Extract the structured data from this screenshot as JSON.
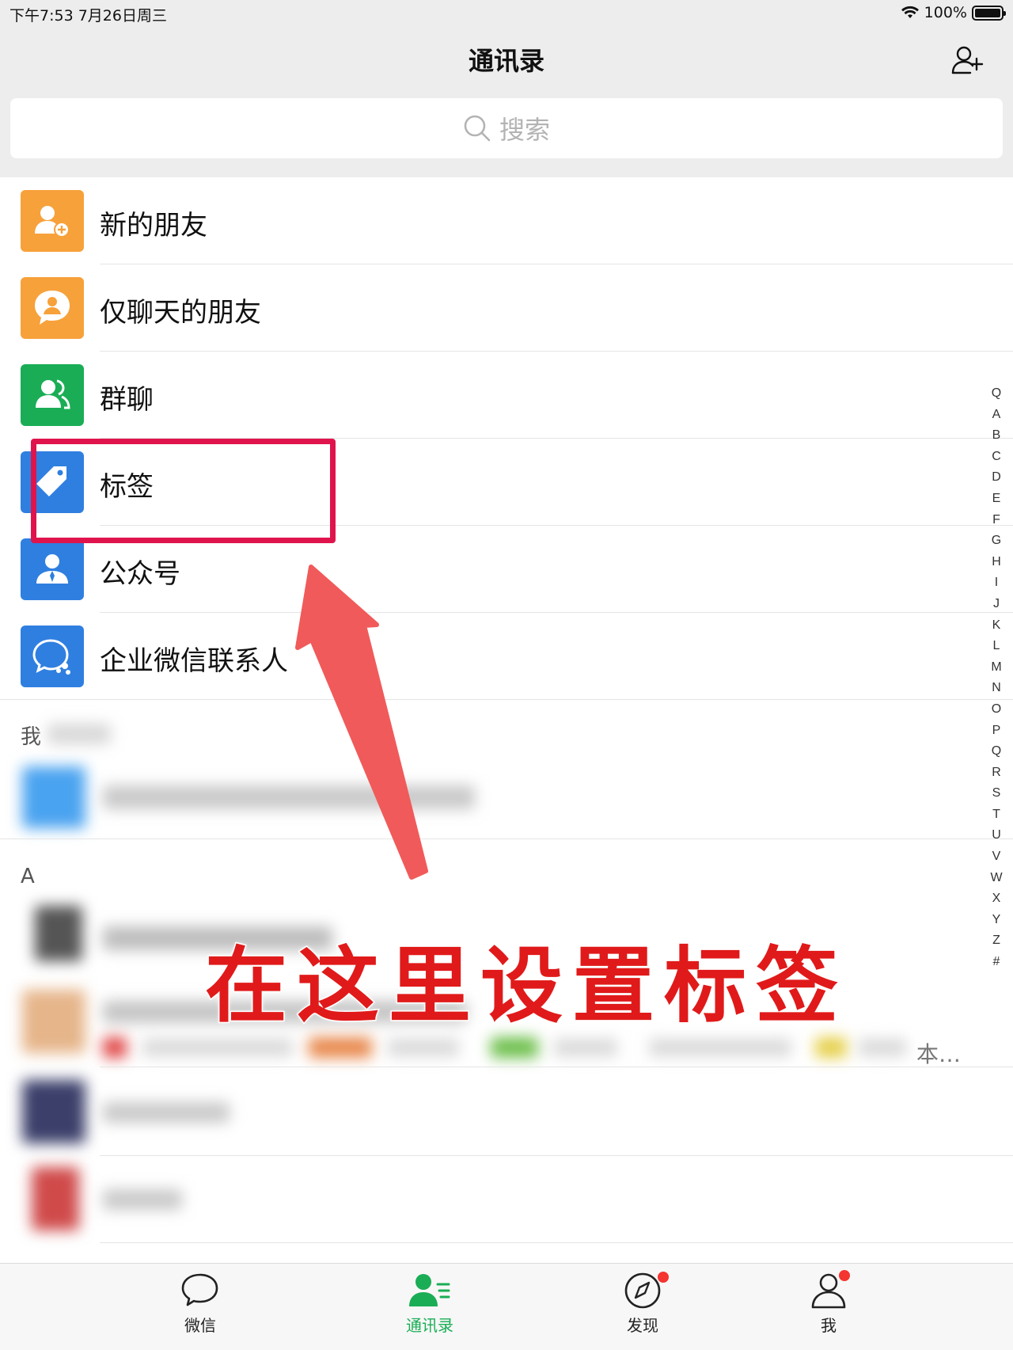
{
  "status_bar": {
    "time": "下午7:53   7月26日周三",
    "battery": "100%"
  },
  "nav": {
    "title": "通讯录",
    "add_contact_icon": "add-contact-icon"
  },
  "search": {
    "placeholder": "搜索"
  },
  "list_items": [
    {
      "label": "新的朋友",
      "icon": "new-friend-icon",
      "color": "#f7a13a"
    },
    {
      "label": "仅聊天的朋友",
      "icon": "chat-only-friend-icon",
      "color": "#f7a13a"
    },
    {
      "label": "群聊",
      "icon": "group-chat-icon",
      "color": "#1aad55"
    },
    {
      "label": "标签",
      "icon": "tag-icon",
      "color": "#2f7fe0"
    },
    {
      "label": "公众号",
      "icon": "official-account-icon",
      "color": "#2f7fe0"
    },
    {
      "label": "企业微信联系人",
      "icon": "wecom-contact-icon",
      "color": "#2f7fe0"
    }
  ],
  "sections": {
    "mine": "我",
    "a": "A",
    "truncated_text": "本…"
  },
  "index_bar": [
    "Q",
    "A",
    "B",
    "C",
    "D",
    "E",
    "F",
    "G",
    "H",
    "I",
    "J",
    "K",
    "L",
    "M",
    "N",
    "O",
    "P",
    "Q",
    "R",
    "S",
    "T",
    "U",
    "V",
    "W",
    "X",
    "Y",
    "Z",
    "#"
  ],
  "annotation": {
    "text": "在这里设置标签"
  },
  "tabs": [
    {
      "label": "微信",
      "icon": "chat-bubble-icon",
      "active": false
    },
    {
      "label": "通讯录",
      "icon": "contacts-icon",
      "active": true
    },
    {
      "label": "发现",
      "icon": "compass-icon",
      "active": false
    },
    {
      "label": "我",
      "icon": "profile-icon",
      "active": false
    }
  ],
  "colors": {
    "accent": "#1aad55",
    "annotation_red": "#e01a1a",
    "highlight_border": "#e0144c",
    "badge": "#f43530"
  }
}
